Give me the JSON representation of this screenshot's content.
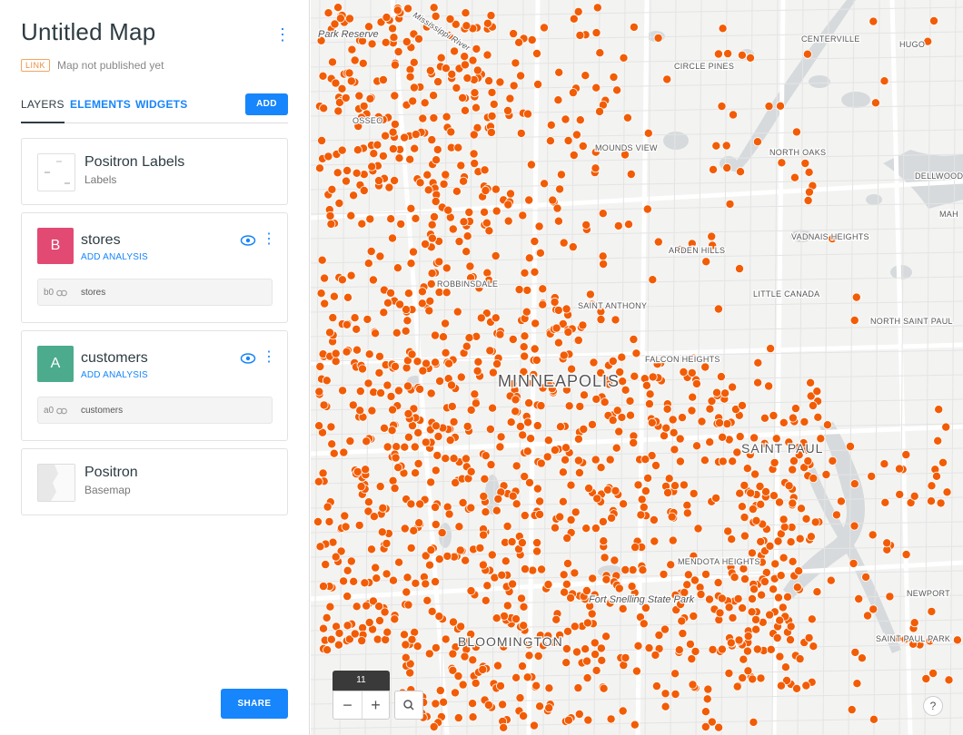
{
  "map": {
    "title": "Untitled Map",
    "link_badge": "LINK",
    "publish_status": "Map not published yet"
  },
  "tabs": [
    {
      "label": "LAYERS",
      "active": true
    },
    {
      "label": "ELEMENTS",
      "active": false
    },
    {
      "label": "WIDGETS",
      "active": false
    }
  ],
  "add_label": "ADD",
  "layers": [
    {
      "title": "Positron Labels",
      "subtitle": "Labels"
    },
    {
      "letter": "B",
      "title": "stores",
      "analysis_label": "ADD ANALYSIS",
      "source_id": "b0",
      "source_name": "stores",
      "color": "#e24a73"
    },
    {
      "letter": "A",
      "title": "customers",
      "analysis_label": "ADD ANALYSIS",
      "source_id": "a0",
      "source_name": "customers",
      "color": "#4bab8c"
    },
    {
      "title": "Positron",
      "subtitle": "Basemap"
    }
  ],
  "share_label": "SHARE",
  "zoom": {
    "level": "11"
  },
  "help_label": "?",
  "point_color": "#f25c05",
  "map_labels": [
    {
      "text": "CENTERVILLE",
      "type": "town"
    },
    {
      "text": "HUGO",
      "type": "town"
    },
    {
      "text": "CIRCLE PINES",
      "type": "town"
    },
    {
      "text": "Park Reserve",
      "type": "park"
    },
    {
      "text": "Mississippi River",
      "type": "water"
    },
    {
      "text": "OSSEO",
      "type": "town"
    },
    {
      "text": "MOUNDS VIEW",
      "type": "town"
    },
    {
      "text": "NORTH OAKS",
      "type": "town"
    },
    {
      "text": "DELLWOOD",
      "type": "town"
    },
    {
      "text": "MAH",
      "type": "town"
    },
    {
      "text": "ARDEN HILLS",
      "type": "town"
    },
    {
      "text": "VADNAIS HEIGHTS",
      "type": "town"
    },
    {
      "text": "ROBBINSDALE",
      "type": "town"
    },
    {
      "text": "LITTLE CANADA",
      "type": "town"
    },
    {
      "text": "SAINT ANTHONY",
      "type": "town"
    },
    {
      "text": "NORTH SAINT PAUL",
      "type": "town"
    },
    {
      "text": "FALCON HEIGHTS",
      "type": "town"
    },
    {
      "text": "MINNEAPOLIS",
      "type": "city"
    },
    {
      "text": "SAINT PAUL",
      "type": "city"
    },
    {
      "text": "MENDOTA HEIGHTS",
      "type": "town"
    },
    {
      "text": "Fort Snelling State Park",
      "type": "park"
    },
    {
      "text": "NEWPORT",
      "type": "town"
    },
    {
      "text": "SAINT PAUL PARK",
      "type": "town"
    },
    {
      "text": "BLOOMINGTON",
      "type": "city"
    }
  ]
}
